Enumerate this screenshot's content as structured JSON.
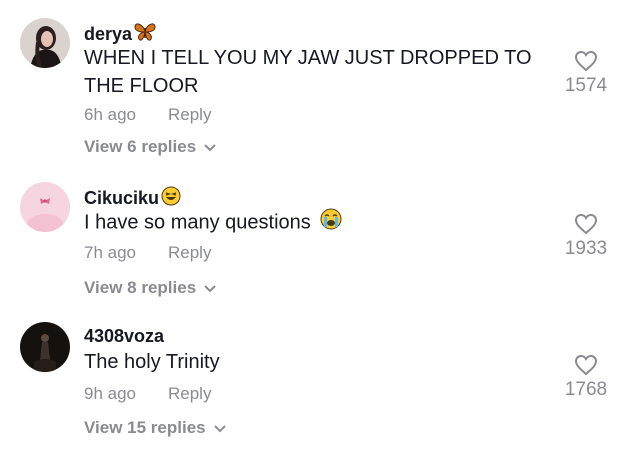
{
  "comments": [
    {
      "username": "derya",
      "username_emoji": "butterfly-icon",
      "text": "WHEN I TELL YOU MY JAW JUST DROPPED TO THE FLOOR",
      "time": "6h ago",
      "reply_label": "Reply",
      "view_replies": "View 6 replies",
      "likes": "1574"
    },
    {
      "username": "Cikuciku",
      "username_emoji": "grinning-squint-face-icon",
      "text": "I have so many questions",
      "text_emoji": "crying-face-icon",
      "time": "7h ago",
      "reply_label": "Reply",
      "view_replies": "View 8 replies",
      "likes": "1933"
    },
    {
      "username": "4308voza",
      "text": "The holy Trinity",
      "time": "9h ago",
      "reply_label": "Reply",
      "view_replies": "View 15 replies",
      "likes": "1768"
    }
  ],
  "colors": {
    "primary_text": "#161823",
    "secondary_text": "#8a8b91"
  }
}
